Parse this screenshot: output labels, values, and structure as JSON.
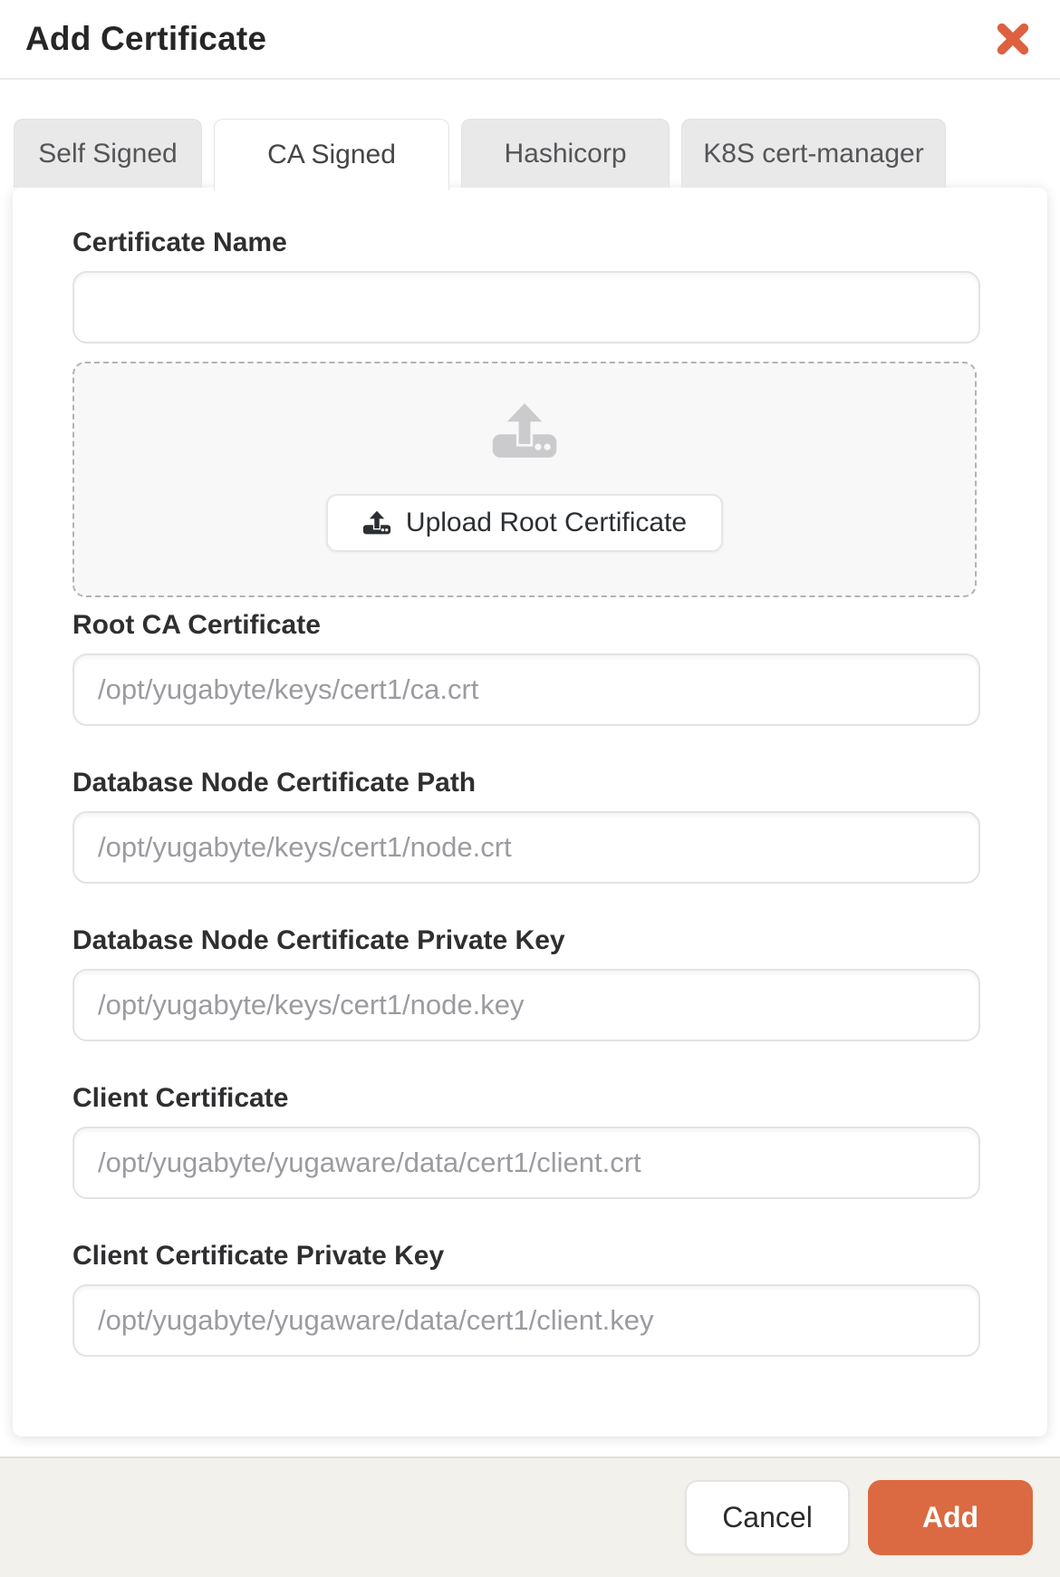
{
  "dialog": {
    "title": "Add Certificate"
  },
  "tabs": [
    {
      "label": "Self Signed",
      "active": false
    },
    {
      "label": "CA Signed",
      "active": true
    },
    {
      "label": "Hashicorp",
      "active": false
    },
    {
      "label": "K8S cert-manager",
      "active": false
    }
  ],
  "form": {
    "certificate_name": {
      "label": "Certificate Name",
      "value": "",
      "placeholder": ""
    },
    "dropzone": {
      "upload_button_label": "Upload Root Certificate",
      "icon": "upload-icon"
    },
    "fields": [
      {
        "label": "Root CA Certificate",
        "value": "",
        "placeholder": "/opt/yugabyte/keys/cert1/ca.crt"
      },
      {
        "label": "Database Node Certificate Path",
        "value": "",
        "placeholder": "/opt/yugabyte/keys/cert1/node.crt"
      },
      {
        "label": "Database Node Certificate Private Key",
        "value": "",
        "placeholder": "/opt/yugabyte/keys/cert1/node.key"
      },
      {
        "label": "Client Certificate",
        "value": "",
        "placeholder": "/opt/yugabyte/yugaware/data/cert1/client.crt"
      },
      {
        "label": "Client Certificate Private Key",
        "value": "",
        "placeholder": "/opt/yugabyte/yugaware/data/cert1/client.key"
      }
    ]
  },
  "footer": {
    "cancel_label": "Cancel",
    "add_label": "Add"
  },
  "colors": {
    "accent_close_x": "#dd6140",
    "add_button_bg": "#db6a42",
    "footer_bg": "#f2f1ec",
    "inactive_tab_bg": "#e9e9ea",
    "dropzone_bg": "#f8f8f8",
    "placeholder_text": "#9b9ba1"
  }
}
